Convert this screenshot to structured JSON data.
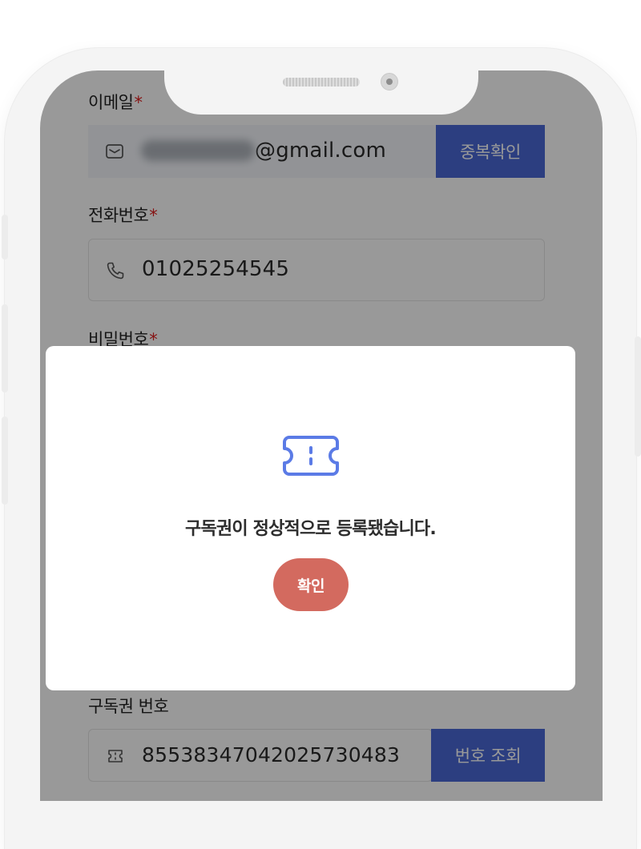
{
  "form": {
    "email": {
      "label": "이메일",
      "required_mark": "*",
      "icon": "mail-icon",
      "value_visible": "gmail.com",
      "value_prefix": "@",
      "button": "중복확인"
    },
    "phone": {
      "label": "전화번호",
      "required_mark": "*",
      "icon": "phone-icon",
      "value": "01025254545"
    },
    "password": {
      "label": "비밀번호",
      "required_mark": "*"
    },
    "subscription": {
      "label": "구독권 번호",
      "icon": "ticket-icon",
      "value": "85538347042025730483",
      "button": "번호 조회"
    }
  },
  "modal": {
    "icon": "ticket-icon",
    "message": "구독권이 정상적으로 등록됐습니다.",
    "confirm_label": "확인"
  },
  "colors": {
    "accent_blue": "#4a68d6",
    "confirm_red": "#d36a5f",
    "icon_blue": "#5b7be6",
    "required_red": "#e02020"
  }
}
